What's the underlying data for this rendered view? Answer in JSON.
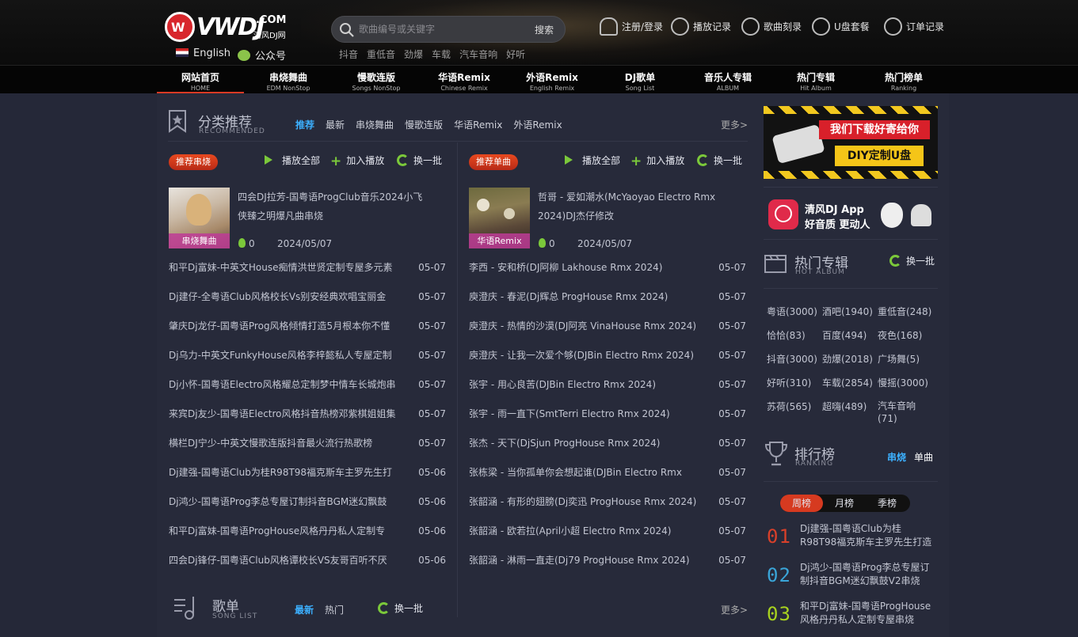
{
  "header": {
    "logo_text": "VWDJ",
    "logo_com": ".COM",
    "logo_sub": "清风DJ网",
    "lang_label": "English",
    "wechat_label": "公众号",
    "search_placeholder": "歌曲编号或关键字",
    "search_button": "搜索",
    "hot_words": [
      "抖音",
      "重低音",
      "劲爆",
      "车载",
      "汽车音响",
      "好听"
    ],
    "nav_links": [
      "注册/登录",
      "播放记录",
      "歌曲刻录",
      "U盘套餐",
      "订单记录"
    ]
  },
  "main_nav": [
    {
      "zh": "网站首页",
      "en": "HOME"
    },
    {
      "zh": "串烧舞曲",
      "en": "EDM NonStop"
    },
    {
      "zh": "慢歌连版",
      "en": "Songs NonStop"
    },
    {
      "zh": "华语Remix",
      "en": "Chinese Remix"
    },
    {
      "zh": "外语Remix",
      "en": "English Remix"
    },
    {
      "zh": "DJ歌单",
      "en": "Song List"
    },
    {
      "zh": "音乐人专辑",
      "en": "ALBUM"
    },
    {
      "zh": "热门专辑",
      "en": "Hit Album"
    },
    {
      "zh": "热门榜单",
      "en": "Ranking"
    }
  ],
  "recommend": {
    "title": "分类推荐",
    "subtitle": "RECOMMENDED",
    "tabs": [
      "推荐",
      "最新",
      "串烧舞曲",
      "慢歌连版",
      "华语Remix",
      "外语Remix"
    ],
    "more": "更多>",
    "play_all": "播放全部",
    "add_play": "加入播放",
    "refresh": "换一批",
    "left": {
      "pill": "推荐串烧",
      "feature": {
        "title": "四会DJ拉芳-国粤语ProgClub音乐2024小飞侠臻之明爆凡曲串烧",
        "badge": "串烧舞曲",
        "count": "0",
        "date": "2024/05/07"
      },
      "items": [
        {
          "title": "和平Dj富妹-中英文House痴情洪世贤定制专屋多元素",
          "date": "05-07"
        },
        {
          "title": "Dj建仔-全粤语Club风格校长Vs别安经典欢唱宝丽金",
          "date": "05-07"
        },
        {
          "title": "肇庆Dj龙仔-国粤语Prog风格倾情打造5月根本你不懂",
          "date": "05-07"
        },
        {
          "title": "Dj乌力-中英文FunkyHouse风格李梓懿私人专屋定制",
          "date": "05-07"
        },
        {
          "title": "Dj小怀-国粤语Electro风格耀总定制梦中情车长城炮串",
          "date": "05-07"
        },
        {
          "title": "来宾Dj友少-国粤语Electro风格抖音热榜邓紫棋姐姐集",
          "date": "05-07"
        },
        {
          "title": "横栏DJ宁少-中英文慢歌连版抖音最火流行热歌榜",
          "date": "05-07"
        },
        {
          "title": "Dj建强-国粤语Club为桂R98T98福克斯车主罗先生打",
          "date": "05-06"
        },
        {
          "title": "Dj鸿少-国粤语Prog李总专屋订制抖音BGM迷幻飘鼓",
          "date": "05-06"
        },
        {
          "title": "和平Dj富妹-国粤语ProgHouse风格丹丹私人定制专",
          "date": "05-06"
        },
        {
          "title": "四会Dj锋仔-国粤语Club风格谭校长VS友哥百听不厌",
          "date": "05-06"
        }
      ]
    },
    "right": {
      "pill": "推荐单曲",
      "feature": {
        "title": "哲哥 - 爱如潮水(McYaoyao Electro Rmx 2024)DJ杰仔修改",
        "badge": "华语Remix",
        "count": "0",
        "date": "2024/05/07"
      },
      "items": [
        {
          "title": "李西 - 安和桥(DJ阿柳 Lakhouse Rmx 2024)",
          "date": "05-07"
        },
        {
          "title": "庾澄庆 - 春泥(Dj辉总 ProgHouse Rmx 2024)",
          "date": "05-07"
        },
        {
          "title": "庾澄庆 - 热情的沙漠(DJ阿亮 VinaHouse Rmx 2024)",
          "date": "05-07"
        },
        {
          "title": "庾澄庆 - 让我一次爱个够(DJBin Electro Rmx 2024)",
          "date": "05-07"
        },
        {
          "title": "张宇 - 用心良苦(DJBin Electro Rmx 2024)",
          "date": "05-07"
        },
        {
          "title": "张宇 - 雨一直下(SmtTerri Electro Rmx 2024)",
          "date": "05-07"
        },
        {
          "title": "张杰 - 天下(DjSjun ProgHouse Rmx 2024)",
          "date": "05-07"
        },
        {
          "title": "张栋梁 - 当你孤单你会想起谁(DJBin Electro Rmx",
          "date": "05-07"
        },
        {
          "title": "张韶涵 - 有形的翅膀(Dj奕迅 ProgHouse Rmx 2024)",
          "date": "05-07"
        },
        {
          "title": "张韶涵 - 欧若拉(April小超 Electro Rmx 2024)",
          "date": "05-07"
        },
        {
          "title": "张韶涵 - 淋雨一直走(Dj79 ProgHouse Rmx 2024)",
          "date": "05-07"
        }
      ]
    }
  },
  "songlist": {
    "title": "歌单",
    "subtitle": "SONG LIST",
    "tabs": [
      "最新",
      "热门"
    ],
    "refresh": "换一批",
    "more": "更多>"
  },
  "banner": {
    "line1": "我们下载好寄给你",
    "line2": "DIY定制U盘"
  },
  "app": {
    "line1": "清风DJ App",
    "line2": "好音质  更动人"
  },
  "hot_album": {
    "title": "热门专辑",
    "subtitle": "HOT ALBUM",
    "refresh": "换一批",
    "tags": [
      "粤语(3000)",
      "酒吧(1940)",
      "重低音(248)",
      "恰恰(83)",
      "百度(494)",
      "夜色(168)",
      "抖音(3000)",
      "劲爆(2018)",
      "广场舞(5)",
      "好听(310)",
      "车载(2854)",
      "慢摇(3000)",
      "苏荷(565)",
      "超嗨(489)",
      "汽车音响(71)"
    ]
  },
  "ranking": {
    "title": "排行榜",
    "subtitle": "RANKING",
    "type_tabs": [
      "串烧",
      "单曲"
    ],
    "period_tabs": [
      "周榜",
      "月榜",
      "季榜"
    ],
    "items": [
      {
        "num": "01",
        "title": "Dj建强-国粤语Club为桂R98T98福克斯车主罗先生打造"
      },
      {
        "num": "02",
        "title": "Dj鸿少-国粤语Prog李总专屋订制抖音BGM迷幻飘鼓V2串烧"
      },
      {
        "num": "03",
        "title": "和平Dj富妹-国粤语ProgHouse风格丹丹私人定制专屋串烧"
      }
    ]
  },
  "colors": {
    "accent_blue": "#3cb0ff",
    "accent_green": "#7bc83a",
    "accent_red": "#d93a24",
    "rank1": "#d8402a",
    "rank2": "#3aa5d8",
    "rank3": "#a8d21f"
  }
}
